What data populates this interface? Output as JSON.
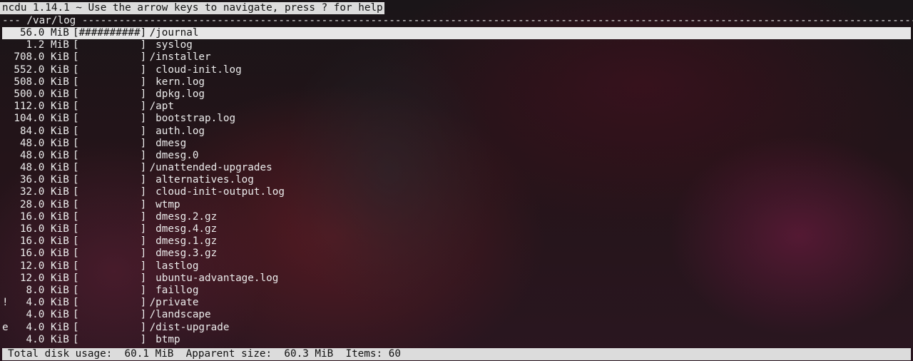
{
  "app": {
    "title": "ncdu 1.14.1 ~ Use the arrow keys to navigate, press ? for help"
  },
  "path_line": "--- /var/log ---------------------------------------------------------------------------------------------------------------------------------------------",
  "entries": [
    {
      "flag": " ",
      "size": "56.0 MiB",
      "bar": "[##########]",
      "name": "/journal",
      "selected": true
    },
    {
      "flag": " ",
      "size": "1.2 MiB",
      "bar": "[          ]",
      "name": " syslog"
    },
    {
      "flag": " ",
      "size": "708.0 KiB",
      "bar": "[          ]",
      "name": "/installer"
    },
    {
      "flag": " ",
      "size": "552.0 KiB",
      "bar": "[          ]",
      "name": " cloud-init.log"
    },
    {
      "flag": " ",
      "size": "508.0 KiB",
      "bar": "[          ]",
      "name": " kern.log"
    },
    {
      "flag": " ",
      "size": "500.0 KiB",
      "bar": "[          ]",
      "name": " dpkg.log"
    },
    {
      "flag": " ",
      "size": "112.0 KiB",
      "bar": "[          ]",
      "name": "/apt"
    },
    {
      "flag": " ",
      "size": "104.0 KiB",
      "bar": "[          ]",
      "name": " bootstrap.log"
    },
    {
      "flag": " ",
      "size": "84.0 KiB",
      "bar": "[          ]",
      "name": " auth.log"
    },
    {
      "flag": " ",
      "size": "48.0 KiB",
      "bar": "[          ]",
      "name": " dmesg"
    },
    {
      "flag": " ",
      "size": "48.0 KiB",
      "bar": "[          ]",
      "name": " dmesg.0"
    },
    {
      "flag": " ",
      "size": "48.0 KiB",
      "bar": "[          ]",
      "name": "/unattended-upgrades"
    },
    {
      "flag": " ",
      "size": "36.0 KiB",
      "bar": "[          ]",
      "name": " alternatives.log"
    },
    {
      "flag": " ",
      "size": "32.0 KiB",
      "bar": "[          ]",
      "name": " cloud-init-output.log"
    },
    {
      "flag": " ",
      "size": "28.0 KiB",
      "bar": "[          ]",
      "name": " wtmp"
    },
    {
      "flag": " ",
      "size": "16.0 KiB",
      "bar": "[          ]",
      "name": " dmesg.2.gz"
    },
    {
      "flag": " ",
      "size": "16.0 KiB",
      "bar": "[          ]",
      "name": " dmesg.4.gz"
    },
    {
      "flag": " ",
      "size": "16.0 KiB",
      "bar": "[          ]",
      "name": " dmesg.1.gz"
    },
    {
      "flag": " ",
      "size": "16.0 KiB",
      "bar": "[          ]",
      "name": " dmesg.3.gz"
    },
    {
      "flag": " ",
      "size": "12.0 KiB",
      "bar": "[          ]",
      "name": " lastlog"
    },
    {
      "flag": " ",
      "size": "12.0 KiB",
      "bar": "[          ]",
      "name": " ubuntu-advantage.log"
    },
    {
      "flag": " ",
      "size": "8.0 KiB",
      "bar": "[          ]",
      "name": " faillog"
    },
    {
      "flag": "!",
      "size": "4.0 KiB",
      "bar": "[          ]",
      "name": "/private"
    },
    {
      "flag": " ",
      "size": "4.0 KiB",
      "bar": "[          ]",
      "name": "/landscape"
    },
    {
      "flag": "e",
      "size": "4.0 KiB",
      "bar": "[          ]",
      "name": "/dist-upgrade"
    },
    {
      "flag": " ",
      "size": "4.0 KiB",
      "bar": "[          ]",
      "name": " btmp"
    }
  ],
  "status": {
    "total_label": "Total disk usage:",
    "total_value": "60.1 MiB",
    "apparent_label": "Apparent size:",
    "apparent_value": "60.3 MiB",
    "items_label": "Items:",
    "items_value": "60"
  }
}
